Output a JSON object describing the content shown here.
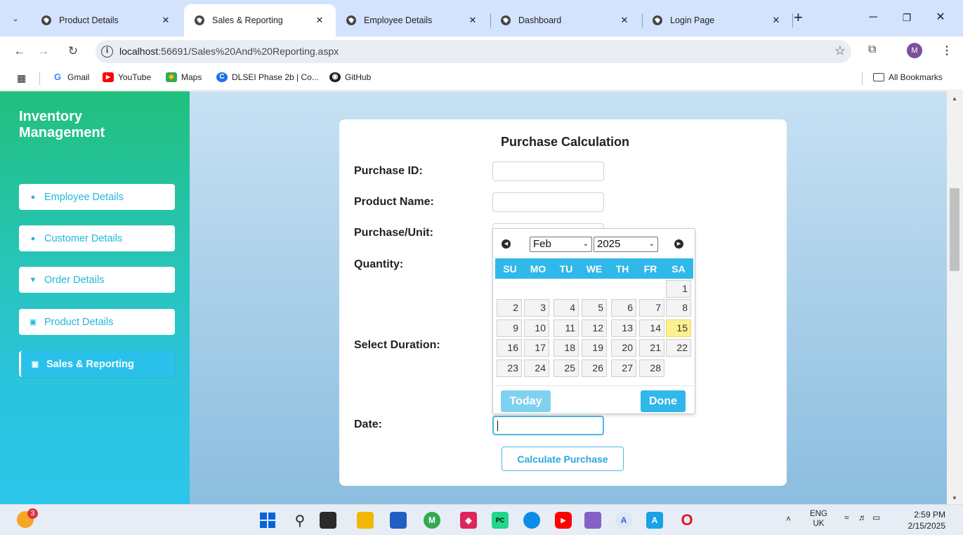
{
  "browser": {
    "tabs": [
      {
        "label": "Product Details",
        "active": false
      },
      {
        "label": "Sales & Reporting",
        "active": true
      },
      {
        "label": "Employee Details",
        "active": false
      },
      {
        "label": "Dashboard",
        "active": false
      },
      {
        "label": "Login Page",
        "active": false
      }
    ],
    "url_host": "localhost",
    "url_path": ":56691/Sales%20And%20Reporting.aspx",
    "avatar_letter": "M",
    "bookmarks": [
      {
        "label": "Gmail",
        "icon": "google-icon"
      },
      {
        "label": "YouTube",
        "icon": "youtube-icon"
      },
      {
        "label": "Maps",
        "icon": "maps-icon"
      },
      {
        "label": "DLSEI Phase 2b | Co...",
        "icon": "dlsei-icon"
      },
      {
        "label": "GitHub",
        "icon": "github-icon"
      }
    ],
    "all_bookmarks": "All Bookmarks"
  },
  "sidebar": {
    "brand_line1": "Inventory",
    "brand_line2": "Management",
    "items": [
      {
        "label": "Employee Details",
        "icon": "user-icon",
        "active": false
      },
      {
        "label": "Customer Details",
        "icon": "users-icon",
        "active": false
      },
      {
        "label": "Order Details",
        "icon": "cart-icon",
        "active": false
      },
      {
        "label": "Product Details",
        "icon": "archive-icon",
        "active": false
      },
      {
        "label": "Sales & Reporting",
        "icon": "chart-icon",
        "active": true
      }
    ]
  },
  "form": {
    "title": "Purchase Calculation",
    "labels": {
      "purchase_id": "Purchase ID:",
      "product_name": "Product Name:",
      "purchase_unit": "Purchase/Unit:",
      "quantity": "Quantity:",
      "select_duration": "Select Duration:",
      "date": "Date:"
    },
    "values": {
      "purchase_id": "",
      "product_name": "",
      "purchase_unit": "",
      "date": ""
    },
    "calculate_label": "Calculate Purchase"
  },
  "datepicker": {
    "month": "Feb",
    "year": "2025",
    "weekdays": [
      "SU",
      "MO",
      "TU",
      "WE",
      "TH",
      "FR",
      "SA"
    ],
    "weeks": [
      [
        "",
        "",
        "",
        "",
        "",
        "",
        "1"
      ],
      [
        "2",
        "3",
        "4",
        "5",
        "6",
        "7",
        "8"
      ],
      [
        "9",
        "10",
        "11",
        "12",
        "13",
        "14",
        "15"
      ],
      [
        "16",
        "17",
        "18",
        "19",
        "20",
        "21",
        "22"
      ],
      [
        "23",
        "24",
        "25",
        "26",
        "27",
        "28",
        ""
      ]
    ],
    "highlighted_day": "15",
    "today_label": "Today",
    "done_label": "Done"
  },
  "taskbar": {
    "weather_badge": "3",
    "lang_line1": "ENG",
    "lang_line2": "UK",
    "time": "2:59 PM",
    "date": "2/15/2025"
  }
}
